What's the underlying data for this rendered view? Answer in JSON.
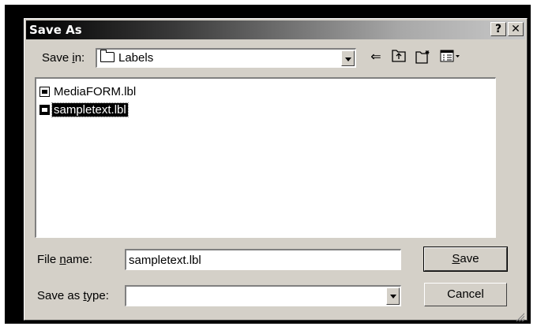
{
  "window": {
    "title": "Save As",
    "help_label": "?",
    "close_label": "✕"
  },
  "save_in": {
    "label_pre": "Save ",
    "label_key": "i",
    "label_post": "n:",
    "value": "Labels"
  },
  "toolbar": {
    "back_icon": "back-arrow-icon",
    "up_icon": "up-one-level-icon",
    "new_folder_icon": "new-folder-icon",
    "view_menu_icon": "view-menu-icon"
  },
  "files": [
    {
      "name": "MediaFORM.lbl",
      "selected": false
    },
    {
      "name": "sampletext.lbl",
      "selected": true
    }
  ],
  "file_name": {
    "label_pre": "File ",
    "label_key": "n",
    "label_post": "ame:",
    "value": "sampletext.lbl"
  },
  "save_type": {
    "label_pre": "Save as ",
    "label_key": "t",
    "label_post": "ype:",
    "value": ""
  },
  "buttons": {
    "save_key": "S",
    "save_rest": "ave",
    "cancel": "Cancel"
  }
}
